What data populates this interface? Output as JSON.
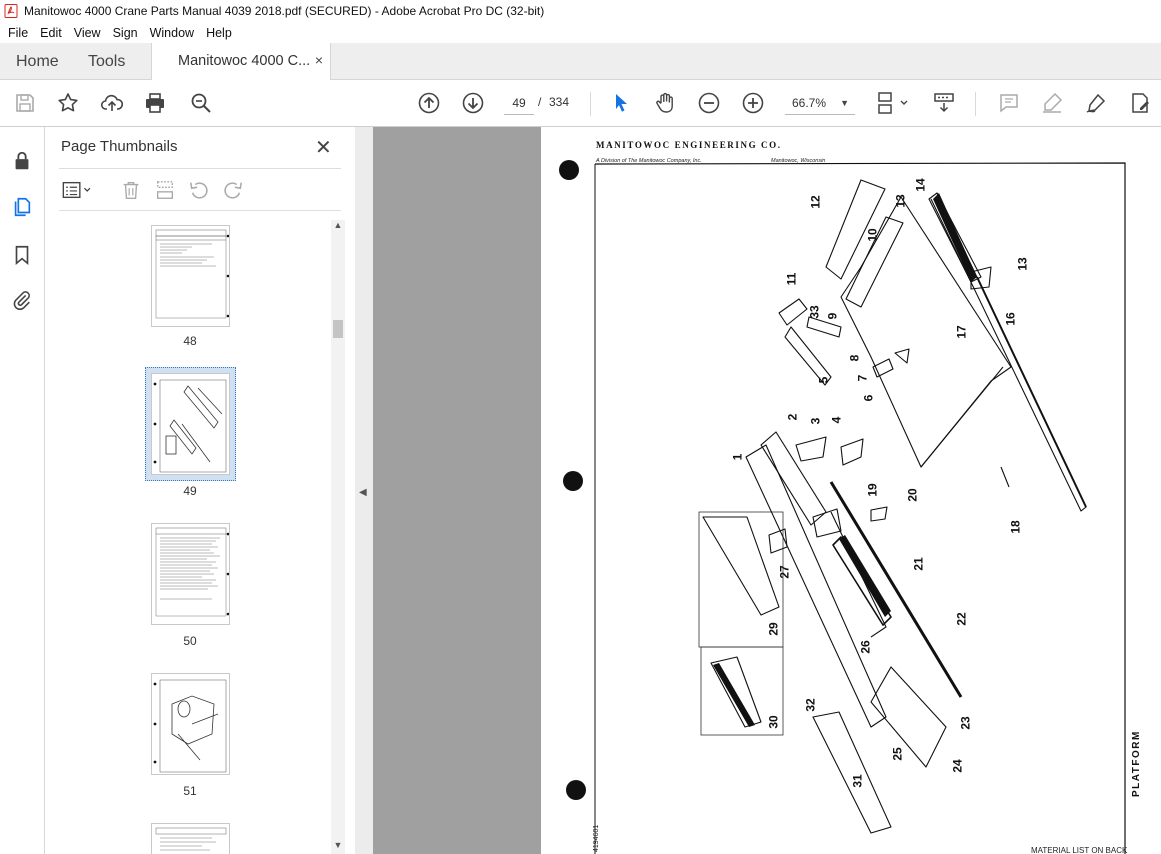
{
  "window": {
    "title": "Manitowoc 4000 Crane Parts Manual 4039 2018.pdf (SECURED) - Adobe Acrobat Pro DC (32-bit)"
  },
  "menu": [
    "File",
    "Edit",
    "View",
    "Sign",
    "Window",
    "Help"
  ],
  "tabs": {
    "home": "Home",
    "tools": "Tools",
    "document": "Manitowoc 4000 C...",
    "close": "×"
  },
  "toolbar": {
    "current_page": "49",
    "separator": "/",
    "total_pages": "334",
    "zoom": "66.7%"
  },
  "icons": {
    "save": "save-icon",
    "bookmark_star": "star-icon",
    "upload": "upload-icon",
    "print": "print-icon",
    "find": "search-icon",
    "prev": "arrow-up-circle-icon",
    "next": "arrow-down-circle-icon",
    "select": "pointer-icon",
    "hand": "hand-icon",
    "zoom_out": "zoom-out-icon",
    "zoom_in": "zoom-in-icon"
  },
  "thumbnail_panel": {
    "title": "Page Thumbnails",
    "close": "✕",
    "pages": [
      {
        "label": "48"
      },
      {
        "label": "49",
        "selected": true
      },
      {
        "label": "50"
      },
      {
        "label": "51"
      }
    ]
  },
  "document_page": {
    "header": "MANITOWOC ENGINEERING CO.",
    "subheader_left": "A Division of The Manitowoc Company, Inc.",
    "subheader_right": "Manitowoc, Wisconsin",
    "side_title": "PLATFORM",
    "bottom_note": "MATERIAL LIST ON BACK",
    "drawing_code": "4194601",
    "callouts": [
      "1",
      "2",
      "3",
      "4",
      "5",
      "6",
      "7",
      "8",
      "9",
      "10",
      "11",
      "12",
      "13",
      "13",
      "14",
      "16",
      "17",
      "18",
      "19",
      "20",
      "21",
      "22",
      "23",
      "24",
      "25",
      "26",
      "27",
      "29",
      "30",
      "31",
      "32",
      "33"
    ]
  },
  "colors": {
    "accent": "#1473e6",
    "doc_background": "#a0a0a0",
    "selection": "#cfe0f2"
  }
}
